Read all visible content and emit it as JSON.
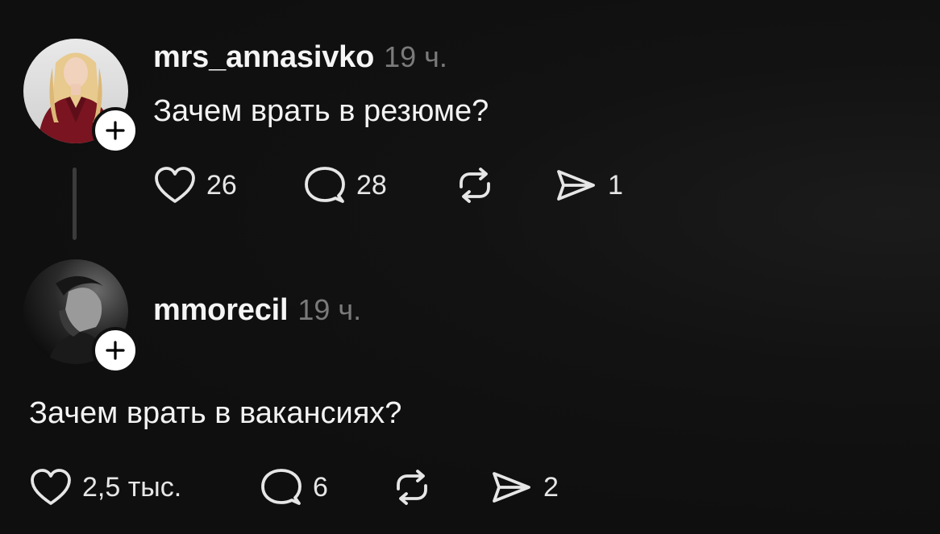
{
  "posts": [
    {
      "username": "mrs_annasivko",
      "time": "19 ч.",
      "text": "Зачем врать в резюме?",
      "likes": "26",
      "replies": "28",
      "shares": "1"
    },
    {
      "username": "mmorecil",
      "time": "19 ч.",
      "text": "Зачем врать в вакансиях?",
      "likes": "2,5 тыс.",
      "replies": "6",
      "shares": "2"
    }
  ],
  "icons": {
    "like": "heart-icon",
    "reply": "speech-bubble-icon",
    "repost": "repost-icon",
    "share": "paper-plane-icon",
    "follow": "plus-icon"
  },
  "colors": {
    "background": "#101010",
    "text": "#f3f3f3",
    "muted": "#7a7a7a",
    "thread_line": "#3b3b3b"
  }
}
